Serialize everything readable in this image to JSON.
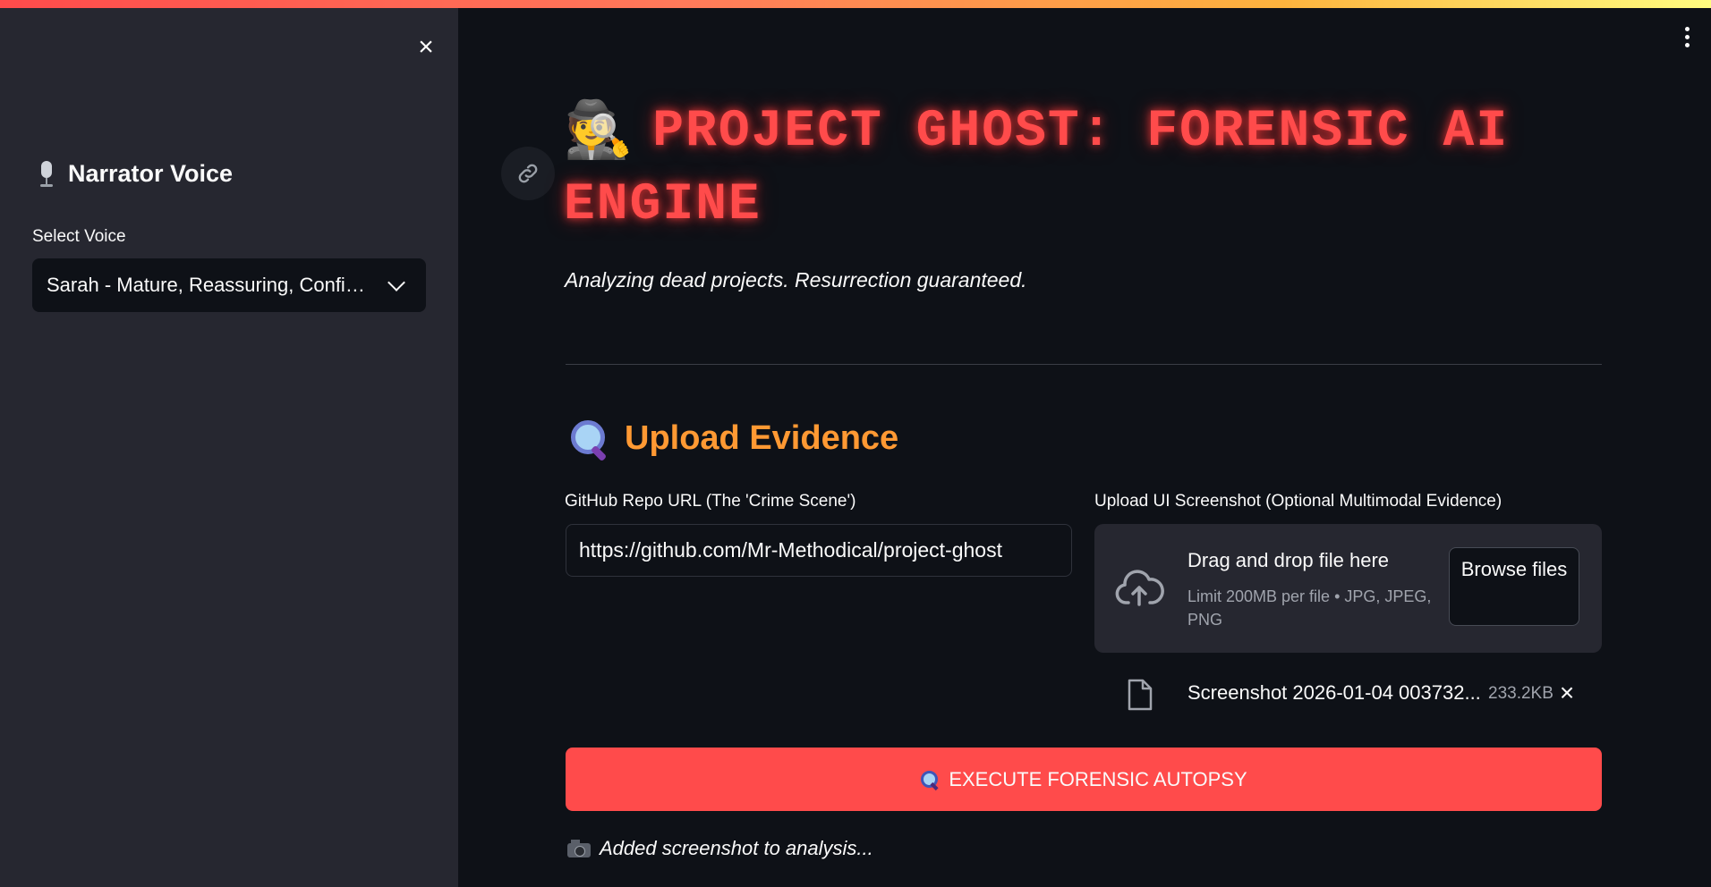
{
  "sidebar": {
    "close_icon": "close-icon",
    "header_icon": "microphone-icon",
    "header": "Narrator Voice",
    "select_label": "Select Voice",
    "select_value": "Sarah - Mature, Reassuring, Confi…"
  },
  "main": {
    "title_icon": "detective-emoji",
    "title": "PROJECT GHOST: FORENSIC AI ENGINE",
    "subtitle": "Analyzing dead projects. Resurrection guaranteed.",
    "section_icon": "magnifying-glass-icon",
    "section_title": "Upload Evidence",
    "repo_label": "GitHub Repo URL (The 'Crime Scene')",
    "repo_value": "https://github.com/Mr-Methodical/project-ghost",
    "upload_label": "Upload UI Screenshot (Optional Multimodal Evidence)",
    "dropzone_main": "Drag and drop file here",
    "dropzone_sub": "Limit 200MB per file • JPG, JPEG, PNG",
    "browse_label": "Browse files",
    "uploaded_file": {
      "name": "Screenshot 2026-01-04 003732...",
      "size": "233.2KB"
    },
    "execute_label": "EXECUTE FORENSIC AUTOPSY",
    "status_text": "Added screenshot to analysis..."
  },
  "colors": {
    "background": "#0e1117",
    "sidebar": "#262730",
    "title": "#ff4b4b",
    "section_title": "#ff9933",
    "primary_button": "#ff4b4b"
  }
}
